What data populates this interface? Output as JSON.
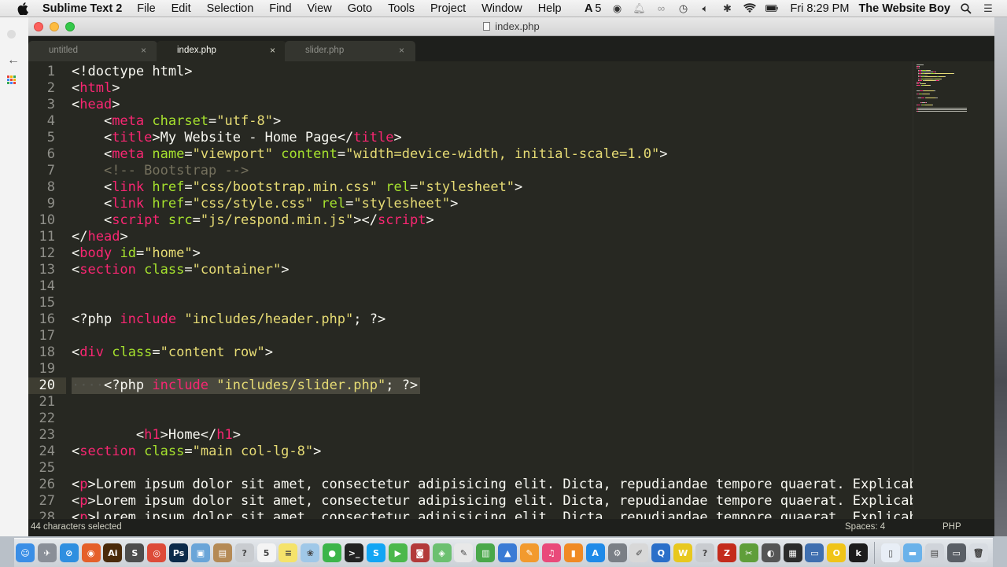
{
  "menubar": {
    "app_name": "Sublime Text 2",
    "menus": [
      "File",
      "Edit",
      "Selection",
      "Find",
      "View",
      "Goto",
      "Tools",
      "Project",
      "Window",
      "Help"
    ],
    "adobe_badge": "5",
    "clock": "Fri 8:29 PM",
    "user": "The Website Boy"
  },
  "window": {
    "title": "index.php",
    "tabs": [
      {
        "label": "untitled",
        "active": false
      },
      {
        "label": "index.php",
        "active": true
      },
      {
        "label": "slider.php",
        "active": false
      }
    ],
    "close_glyph": "×"
  },
  "editor": {
    "current_line": 20,
    "lines": [
      {
        "n": "1",
        "segs": [
          [
            "t",
            "<!doctype html>"
          ]
        ]
      },
      {
        "n": "2",
        "segs": [
          [
            "t",
            "<"
          ],
          [
            "tag",
            "html"
          ],
          [
            "t",
            ">"
          ]
        ]
      },
      {
        "n": "3",
        "segs": [
          [
            "t",
            "<"
          ],
          [
            "tag",
            "head"
          ],
          [
            "t",
            ">"
          ]
        ]
      },
      {
        "n": "4",
        "segs": [
          [
            "t",
            "    <"
          ],
          [
            "tag",
            "meta"
          ],
          [
            "t",
            " "
          ],
          [
            "attr",
            "charset"
          ],
          [
            "t",
            "="
          ],
          [
            "str",
            "\"utf-8\""
          ],
          [
            "t",
            ">"
          ]
        ]
      },
      {
        "n": "5",
        "segs": [
          [
            "t",
            "    <"
          ],
          [
            "tag",
            "title"
          ],
          [
            "t",
            ">My Website - Home Page</"
          ],
          [
            "tag",
            "title"
          ],
          [
            "t",
            ">"
          ]
        ]
      },
      {
        "n": "6",
        "segs": [
          [
            "t",
            "    <"
          ],
          [
            "tag",
            "meta"
          ],
          [
            "t",
            " "
          ],
          [
            "attr",
            "name"
          ],
          [
            "t",
            "="
          ],
          [
            "str",
            "\"viewport\""
          ],
          [
            "t",
            " "
          ],
          [
            "attr",
            "content"
          ],
          [
            "t",
            "="
          ],
          [
            "str",
            "\"width=device-width, initial-scale=1.0\""
          ],
          [
            "t",
            ">"
          ]
        ]
      },
      {
        "n": "7",
        "segs": [
          [
            "t",
            "    "
          ],
          [
            "com",
            "<!-- Bootstrap -->"
          ]
        ]
      },
      {
        "n": "8",
        "segs": [
          [
            "t",
            "    <"
          ],
          [
            "tag",
            "link"
          ],
          [
            "t",
            " "
          ],
          [
            "attr",
            "href"
          ],
          [
            "t",
            "="
          ],
          [
            "str",
            "\"css/bootstrap.min.css\""
          ],
          [
            "t",
            " "
          ],
          [
            "attr",
            "rel"
          ],
          [
            "t",
            "="
          ],
          [
            "str",
            "\"stylesheet\""
          ],
          [
            "t",
            ">"
          ]
        ]
      },
      {
        "n": "9",
        "segs": [
          [
            "t",
            "    <"
          ],
          [
            "tag",
            "link"
          ],
          [
            "t",
            " "
          ],
          [
            "attr",
            "href"
          ],
          [
            "t",
            "="
          ],
          [
            "str",
            "\"css/style.css\""
          ],
          [
            "t",
            " "
          ],
          [
            "attr",
            "rel"
          ],
          [
            "t",
            "="
          ],
          [
            "str",
            "\"stylesheet\""
          ],
          [
            "t",
            ">"
          ]
        ]
      },
      {
        "n": "10",
        "segs": [
          [
            "t",
            "    <"
          ],
          [
            "tag",
            "script"
          ],
          [
            "t",
            " "
          ],
          [
            "attr",
            "src"
          ],
          [
            "t",
            "="
          ],
          [
            "str",
            "\"js/respond.min.js\""
          ],
          [
            "t",
            "></"
          ],
          [
            "tag",
            "script"
          ],
          [
            "t",
            ">"
          ]
        ]
      },
      {
        "n": "11",
        "segs": [
          [
            "t",
            "</"
          ],
          [
            "tag",
            "head"
          ],
          [
            "t",
            ">"
          ]
        ]
      },
      {
        "n": "12",
        "segs": [
          [
            "t",
            "<"
          ],
          [
            "tag",
            "body"
          ],
          [
            "t",
            " "
          ],
          [
            "attr",
            "id"
          ],
          [
            "t",
            "="
          ],
          [
            "str",
            "\"home\""
          ],
          [
            "t",
            ">"
          ]
        ]
      },
      {
        "n": "13",
        "segs": [
          [
            "t",
            "<"
          ],
          [
            "tag",
            "section"
          ],
          [
            "t",
            " "
          ],
          [
            "attr",
            "class"
          ],
          [
            "t",
            "="
          ],
          [
            "str",
            "\"container\""
          ],
          [
            "t",
            ">"
          ]
        ]
      },
      {
        "n": "14",
        "segs": []
      },
      {
        "n": "15",
        "segs": []
      },
      {
        "n": "16",
        "segs": [
          [
            "t",
            "<?php "
          ],
          [
            "kw",
            "include"
          ],
          [
            "t",
            " "
          ],
          [
            "str",
            "\"includes/header.php\""
          ],
          [
            "t",
            "; ?>"
          ]
        ]
      },
      {
        "n": "17",
        "segs": []
      },
      {
        "n": "18",
        "segs": [
          [
            "t",
            "<"
          ],
          [
            "tag",
            "div"
          ],
          [
            "t",
            " "
          ],
          [
            "attr",
            "class"
          ],
          [
            "t",
            "="
          ],
          [
            "str",
            "\"content row\""
          ],
          [
            "t",
            ">"
          ]
        ]
      },
      {
        "n": "19",
        "segs": []
      },
      {
        "n": "20",
        "segs": [
          [
            "ws",
            "····"
          ],
          [
            "t",
            "<?php "
          ],
          [
            "kw",
            "include"
          ],
          [
            "t",
            " "
          ],
          [
            "str",
            "\"includes/slider.php\""
          ],
          [
            "t",
            "; ?>"
          ]
        ]
      },
      {
        "n": "21",
        "segs": []
      },
      {
        "n": "22",
        "segs": []
      },
      {
        "n": "23",
        "segs": [
          [
            "t",
            "        <"
          ],
          [
            "tag",
            "h1"
          ],
          [
            "t",
            ">Home</"
          ],
          [
            "tag",
            "h1"
          ],
          [
            "t",
            ">"
          ]
        ]
      },
      {
        "n": "24",
        "segs": [
          [
            "t",
            "<"
          ],
          [
            "tag",
            "section"
          ],
          [
            "t",
            " "
          ],
          [
            "attr",
            "class"
          ],
          [
            "t",
            "="
          ],
          [
            "str",
            "\"main col-lg-8\""
          ],
          [
            "t",
            ">"
          ]
        ]
      },
      {
        "n": "25",
        "segs": []
      },
      {
        "n": "26",
        "segs": [
          [
            "t",
            "<"
          ],
          [
            "tag",
            "p"
          ],
          [
            "t",
            ">Lorem ipsum dolor sit amet, consectetur adipisicing elit. Dicta, repudiandae tempore quaerat. Explicabo"
          ]
        ]
      },
      {
        "n": "27",
        "segs": [
          [
            "t",
            "<"
          ],
          [
            "tag",
            "p"
          ],
          [
            "t",
            ">Lorem ipsum dolor sit amet, consectetur adipisicing elit. Dicta, repudiandae tempore quaerat. Explicabo"
          ]
        ]
      },
      {
        "n": "28",
        "segs": [
          [
            "t",
            "<"
          ],
          [
            "tag",
            "p"
          ],
          [
            "t",
            ">Lorem ipsum dolor sit amet, consectetur adipisicing elit. Dicta, repudiandae tempore quaerat. Explicabo"
          ]
        ]
      }
    ]
  },
  "statusbar": {
    "selection": "44 characters selected",
    "spaces": "Spaces: 4",
    "syntax": "PHP"
  },
  "dock": {
    "icons": [
      {
        "name": "finder-icon",
        "color": "#3a8ee6",
        "glyph": "☺"
      },
      {
        "name": "launchpad-icon",
        "color": "#8a8f98",
        "glyph": "✈"
      },
      {
        "name": "safari-icon",
        "color": "#2f8fe0",
        "glyph": "⊘"
      },
      {
        "name": "firefox-icon",
        "color": "#e5602a",
        "glyph": "◉"
      },
      {
        "name": "illustrator-icon",
        "color": "#4a2a0a",
        "glyph": "Ai"
      },
      {
        "name": "sublime-icon",
        "color": "#4d4d4d",
        "glyph": "S"
      },
      {
        "name": "chrome-icon",
        "color": "#dd4b39",
        "glyph": "◎"
      },
      {
        "name": "photoshop-icon",
        "color": "#0b2a4a",
        "glyph": "Ps"
      },
      {
        "name": "preview-icon",
        "color": "#6aa5d8",
        "glyph": "▣"
      },
      {
        "name": "contacts-icon",
        "color": "#b58a55",
        "glyph": "▤"
      },
      {
        "name": "help-icon",
        "color": "#c9ccd0",
        "glyph": "?"
      },
      {
        "name": "calendar-icon",
        "color": "#f4f4f4",
        "glyph": "5"
      },
      {
        "name": "notes-icon",
        "color": "#f5e36b",
        "glyph": "≡"
      },
      {
        "name": "photos-icon",
        "color": "#a0c8e8",
        "glyph": "❀"
      },
      {
        "name": "messages-icon",
        "color": "#3cb54a",
        "glyph": "●"
      },
      {
        "name": "terminal-icon",
        "color": "#222222",
        "glyph": ">_"
      },
      {
        "name": "skype-icon",
        "color": "#12a5f4",
        "glyph": "S"
      },
      {
        "name": "facetime-icon",
        "color": "#4cb84c",
        "glyph": "▶"
      },
      {
        "name": "photobooth-icon",
        "color": "#b33a3a",
        "glyph": "◙"
      },
      {
        "name": "maps-icon",
        "color": "#6cc070",
        "glyph": "◈"
      },
      {
        "name": "textedit-icon",
        "color": "#e8e8e8",
        "glyph": "✎"
      },
      {
        "name": "numbers-icon",
        "color": "#4aa84a",
        "glyph": "▥"
      },
      {
        "name": "keynote-icon",
        "color": "#3a7bd5",
        "glyph": "▲"
      },
      {
        "name": "pages-icon",
        "color": "#f29a2e",
        "glyph": "✎"
      },
      {
        "name": "itunes-icon",
        "color": "#e94a7a",
        "glyph": "♫"
      },
      {
        "name": "ibooks-icon",
        "color": "#f08a24",
        "glyph": "▮"
      },
      {
        "name": "appstore-icon",
        "color": "#1f8ae8",
        "glyph": "A"
      },
      {
        "name": "system-preferences-icon",
        "color": "#7a7f86",
        "glyph": "⚙"
      },
      {
        "name": "script-editor-icon",
        "color": "#d8d8d8",
        "glyph": "✐"
      },
      {
        "name": "magnifier-icon",
        "color": "#2a6fc9",
        "glyph": "Q"
      },
      {
        "name": "vectorworks-icon",
        "color": "#e8c81e",
        "glyph": "W"
      },
      {
        "name": "help-2-icon",
        "color": "#c9ccd0",
        "glyph": "?"
      },
      {
        "name": "filezilla-icon",
        "color": "#c42b1c",
        "glyph": "Z"
      },
      {
        "name": "utility-icon",
        "color": "#5f9e3a",
        "glyph": "✂"
      },
      {
        "name": "github-icon",
        "color": "#555555",
        "glyph": "◐"
      },
      {
        "name": "activity-monitor-icon",
        "color": "#2b2b2b",
        "glyph": "▦"
      },
      {
        "name": "device-icon",
        "color": "#3f6fb0",
        "glyph": "▭"
      },
      {
        "name": "norton-icon",
        "color": "#f0c419",
        "glyph": "O"
      },
      {
        "name": "kindle-icon",
        "color": "#1c1c1c",
        "glyph": "k"
      }
    ],
    "right_icons": [
      {
        "name": "documents-stack-icon",
        "color": "#e8eef6",
        "glyph": "▯"
      },
      {
        "name": "folder-icon",
        "color": "#6ab2ea",
        "glyph": "▬"
      },
      {
        "name": "downloads-stack-icon",
        "color": "#d0d4da",
        "glyph": "▤"
      },
      {
        "name": "screens-stack-icon",
        "color": "#5a5f66",
        "glyph": "▭"
      },
      {
        "name": "trash-icon",
        "color": "#d8dce2",
        "glyph": "🗑"
      }
    ]
  }
}
